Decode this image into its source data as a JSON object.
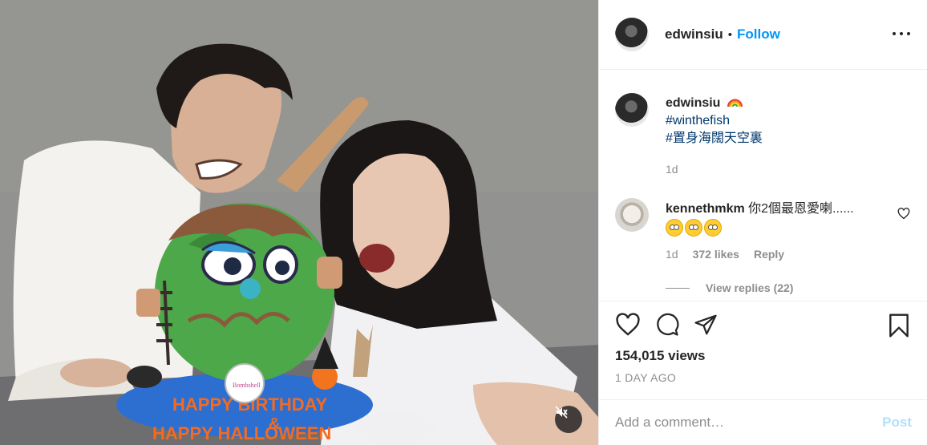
{
  "post": {
    "username": "edwinsiu",
    "dot": "•",
    "follow_label": "Follow",
    "caption_username": "edwinsiu",
    "caption_emoji": "rainbow-emoji",
    "hashtags": [
      "#winthefish",
      "#置身海闊天空裏"
    ],
    "caption_time": "1d",
    "views": "154,015 views",
    "posted_label": "1 DAY AGO",
    "add_comment_placeholder": "Add a comment…",
    "post_label": "Post"
  },
  "comment": {
    "username": "kennethmkm",
    "text": "你2個最恩愛喇......",
    "emoji": [
      "face-with-rolling-eyes",
      "face-with-rolling-eyes",
      "face-with-rolling-eyes"
    ],
    "time": "1d",
    "likes": "372 likes",
    "reply_label": "Reply",
    "view_replies": "View replies (22)"
  },
  "media": {
    "cake_text_line1": "HAPPY BIRTHDAY",
    "cake_text_line2": "&",
    "cake_text_line3": "HAPPY HALLOWEEN",
    "logo_text": "Bombshell",
    "mute_icon": "muted-speaker-icon"
  },
  "colors": {
    "accent": "#0095f6",
    "hashtag": "#00376b",
    "muted_text": "#8e8e8e",
    "post_disabled": "#b2dffc"
  }
}
